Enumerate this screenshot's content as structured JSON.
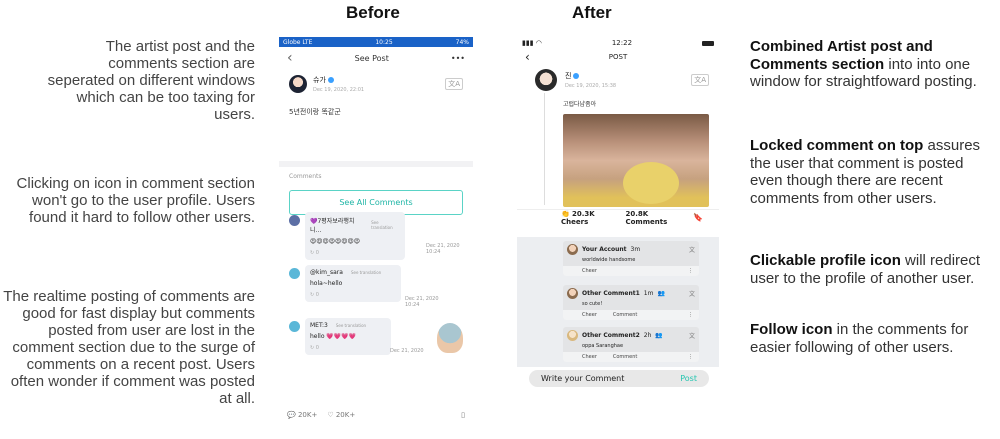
{
  "headings": {
    "before": "Before",
    "after": "After"
  },
  "left_notes": [
    "The artist post and the comments section are seperated on different windows which can be too taxing for users.",
    "Clicking on icon in comment section won't go to the user profile. Users found it hard to follow other users.",
    "The realtime posting of comments are good for fast display but comments posted from user are lost in the comment section due to the surge of comments on a recent post. Users often wonder if comment was posted at all."
  ],
  "right_notes": [
    {
      "bold": "Combined Artist post and Comments section",
      "rest": " into into one window for straightfoward posting."
    },
    {
      "bold": "Locked comment on top",
      "rest": " assures the user that comment is posted even though there are recent comments from other users."
    },
    {
      "bold": "Clickable profile icon",
      "rest": " will redirect user to the profile of another user."
    },
    {
      "bold": "Follow icon",
      "rest": " in the comments for easier following of other users."
    }
  ],
  "before": {
    "status": {
      "carrier": "Globe  LTE",
      "time": "10:25",
      "battery": "74%"
    },
    "nav": {
      "back": "‹",
      "title": "See Post",
      "more": "•••"
    },
    "post": {
      "author": "슈가",
      "date": "Dec 19, 2020, 22:01",
      "body": "5년전이랑 똑같군",
      "translate": "文A"
    },
    "comments_label": "Comments",
    "see_all": "See All Comments",
    "comments": [
      {
        "user": "💜7평자보라행치니...",
        "translation": "See translation",
        "text": "😍😍😍😍😍😍😍😍",
        "replies": "0",
        "date": "Dec 21, 2020\n10:24"
      },
      {
        "user": "@kim_sara",
        "translation": "See translation",
        "text": "hola~hello",
        "replies": "0",
        "date": "Dec 21, 2020\n10:24"
      },
      {
        "user": "MET:3",
        "translation": "See translation",
        "text": "hello 💗💗💗💗",
        "replies": "0",
        "date": "Dec 21, 2020"
      }
    ],
    "footer": {
      "comments": "20K+",
      "likes": "20K+"
    }
  },
  "after": {
    "status": {
      "signal": "▮▮▮ ◠",
      "time": "12:22"
    },
    "nav": {
      "back": "‹",
      "title": "POST"
    },
    "post": {
      "author": "진",
      "date": "Dec 19, 2020, 15:38",
      "body": "고럽다냠좀아",
      "translate": "文A"
    },
    "stats": {
      "cheers": "20.3K Cheers",
      "comments": "20.8K Comments"
    },
    "comments": [
      {
        "user": "Your Account",
        "time": "3m",
        "text": "worldwide handsome",
        "acts": [
          "Cheer"
        ]
      },
      {
        "user": "Other Comment1",
        "time": "1m",
        "text": "so cute!",
        "acts": [
          "Cheer",
          "Comment"
        ]
      },
      {
        "user": "Other Comment2",
        "time": "2h",
        "text": "oppa Saranghae",
        "acts": [
          "Cheer",
          "Comment"
        ]
      }
    ],
    "input": {
      "placeholder": "Write your Comment",
      "post": "Post"
    }
  }
}
